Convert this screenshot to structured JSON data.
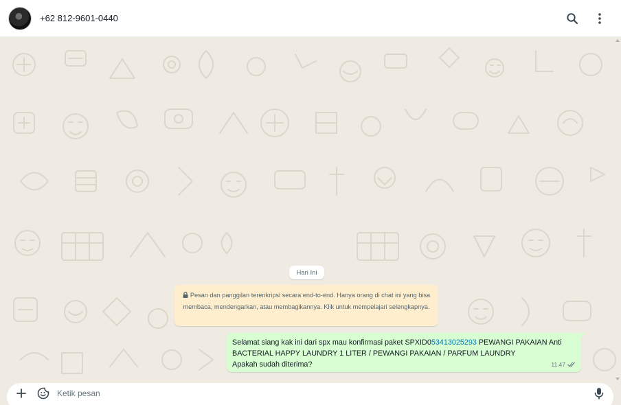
{
  "header": {
    "contact_name": "+62 812-9601-0440",
    "icons": [
      "search-icon",
      "menu-icon"
    ]
  },
  "chat": {
    "date_chip": "Hari Ini",
    "encryption_notice": "Pesan dan panggilan terenkripsi secara end-to-end. Hanya orang di chat ini yang bisa membaca, mendengarkan, atau membagikannya. Klik untuk mempelajari selengkapnya.",
    "message": {
      "prefix": "Selamat siang kak ini dari spx mau konfirmasi paket SPXID0",
      "link": "53413025293",
      "suffix": " PEWANGI PAKAIAN Anti BACTERIAL HAPPY LAUNDRY 1 LITER / PEWANGI PAKAIAN / PARFUM LAUNDRY",
      "question": "Apakah sudah diterima?",
      "time": "11.47",
      "status": "read"
    }
  },
  "composer": {
    "placeholder": "Ketik pesan",
    "icons": [
      "plus-icon",
      "sticker-icon",
      "microphone-icon"
    ]
  },
  "colors": {
    "chat_bg": "#efeae2",
    "outgoing_bubble": "#d9fdd3",
    "notice_bg": "#ffeecd",
    "link": "#027eb5"
  }
}
